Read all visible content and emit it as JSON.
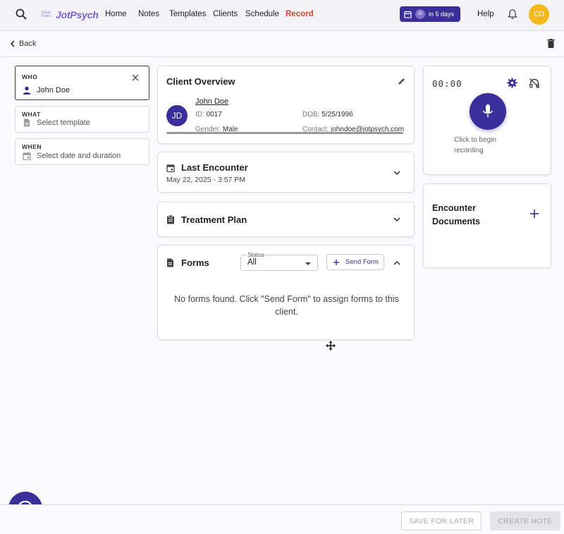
{
  "nav": {
    "logo_small": "Smart Notes",
    "logo": "JotPsych",
    "links": [
      "Home",
      "Notes",
      "Templates",
      "Clients",
      "Schedule",
      "Record"
    ],
    "active_link": "Record",
    "appointment_initials": "JD",
    "appointment_text": "in 5 days",
    "help": "Help",
    "user_initials": "CO"
  },
  "back_label": "Back",
  "who": {
    "label": "WHO",
    "value": "John Doe"
  },
  "what": {
    "label": "WHAT",
    "placeholder": "Select template"
  },
  "when": {
    "label": "WHEN",
    "placeholder": "Select date and duration"
  },
  "client_overview": {
    "title": "Client Overview",
    "initials": "JD",
    "name": "John Doe",
    "id_label": "ID:",
    "id_value": "0017",
    "dob_label": "DOB:",
    "dob_value": "5/25/1996",
    "gender_label": "Gender:",
    "gender_value": "Male",
    "contact_label": "Contact:",
    "contact_value": "johndoe@jotpsych.com"
  },
  "last_encounter": {
    "title": "Last Encounter",
    "date": "May 22, 2025 - 3:57 PM"
  },
  "treatment_plan": {
    "title": "Treatment Plan"
  },
  "forms": {
    "title": "Forms",
    "status_label": "Status",
    "status_value": "All",
    "send_form": "Send Form",
    "empty_message": "No forms found. Click \"Send Form\" to assign forms to this client."
  },
  "recorder": {
    "timer": "00:00",
    "hint": "Click to begin recording"
  },
  "encounter_documents": {
    "title": "Encounter Documents"
  },
  "footer": {
    "save_later": "SAVE FOR LATER",
    "create_note": "CREATE NOTE"
  },
  "colors": {
    "primary": "#3a2e9a",
    "record_active": "#d4472f",
    "avatar": "#f2b91a"
  }
}
